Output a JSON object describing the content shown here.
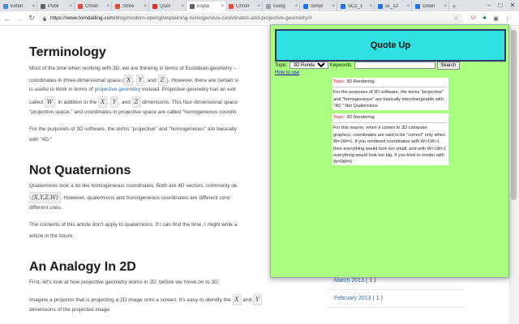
{
  "browser": {
    "tabs": [
      {
        "label": "Exten",
        "color": "#4a8ad6"
      },
      {
        "label": "Publi",
        "color": "#5f6368"
      },
      {
        "label": "Chron",
        "color": "#e04b3a"
      },
      {
        "label": "Store",
        "color": "#e04b3a"
      },
      {
        "label": "Quot",
        "color": "#d93025"
      },
      {
        "label": "Expla",
        "color": "#5f6368",
        "active": true
      },
      {
        "label": "Chron",
        "color": "#e04b3a"
      },
      {
        "label": "Goog",
        "color": "#9aa0a6"
      },
      {
        "label": "Simpl",
        "color": "#1a73e8"
      },
      {
        "label": "SC2_1",
        "color": "#1a73e8"
      },
      {
        "label": "sc_12",
        "color": "#1a73e8"
      },
      {
        "label": "Down",
        "color": "#1a73e8"
      }
    ],
    "new_tab": "+",
    "window_controls": {
      "minimize": "–",
      "maximize": "□",
      "close": "✕"
    },
    "url_host": "https://www.tomdalling.com",
    "url_path": "/blog/modern-opengl/explaining-homogenous-coordinates-and-projective-geometry/#"
  },
  "article": {
    "h_terminology": "Terminology",
    "p1_a": "Most of the time when working with 3D, we are thinking in terms of Euclidean geometry –",
    "p1_b": "coordinates in three-dimensional space (",
    "p1_x": "X",
    "p1_y": "Y",
    "p1_z": "Z",
    "p1_c": "). However, there are certain si",
    "p2_link": "projective geometry",
    "p2_pre": "is useful to think in terms of ",
    "p2_post": " instead. Projective geometry has an extr",
    "p3_pre": "called ",
    "p3_w": "W",
    "p3_mid": ", in addition to the ",
    "p3_x": "X",
    "p3_y": "Y",
    "p3_z": "Z",
    "p3_post": " dimensions. This four-dimensional space",
    "p4": "\"projective space,\" and coordinates in projective space are called \"homogeneous coordin",
    "p5_a": "For the purposes of 3D software, the terms \"projective\" and \"homogeneous\" are basically",
    "p5_b": "with \"4D.\"",
    "h_notquat": "Not Quaternions",
    "q1": "Quaternions look a lot like homogeneous coordinates. Both are 4D vectors, commonly de",
    "q2_math": "(X,Y,Z,W)",
    "q2_post": ". However, quaternions and homogeneous coordinates are different conc",
    "q3": "different uses.",
    "c1": "The contents of this article don't apply to quaternions. If I can find the time, I might write a",
    "c2": "article in the future.",
    "h_analogy": "An Analogy In 2D",
    "a1": "First, let's look at how projective geometry works in 2D, before we move on to 3D.",
    "a2_pre": "Imagine a projector that is projecting a 2D image onto a screen. It's easy to identify the ",
    "a2_x": "X",
    "a2_mid": " and ",
    "a2_y": "Y",
    "a3": "dimensions of the projected image."
  },
  "sidebar": {
    "archives": [
      {
        "label": "March 2013",
        "count": "( 1 )"
      },
      {
        "label": "February 2013",
        "count": "( 1 )"
      }
    ]
  },
  "popup": {
    "title": "Quote Up",
    "topic_label": "Topic:",
    "topic_value": "3D Rendering",
    "keywords_label": "Keywords:",
    "keywords_value": "",
    "search_label": "Search",
    "howto": "How to use",
    "quotes": [
      {
        "topic_label": "Topic:",
        "topic": "3D Rendering",
        "text": "For the purposes of 3D software, the terms \"projective\" and \"homogeneous\" are basically interchangeable with \"4D.\" Not Quaternions"
      },
      {
        "topic_label": "Topic:",
        "topic": "3D Rendering",
        "text": "For this reason, when it comes to 3D computer graphics, coordinates are said to be \"correct\" only when W=1W=1. If you rendered coordinates with W>1W>1 then everything would look too small, and with W<1W<1 everything would look too big. If you tried to render with W=0W=0"
      }
    ]
  },
  "colors": {
    "popup_bg": "#aaff80",
    "header_bg": "#2ee0e0",
    "link": "#2a6fb0"
  }
}
